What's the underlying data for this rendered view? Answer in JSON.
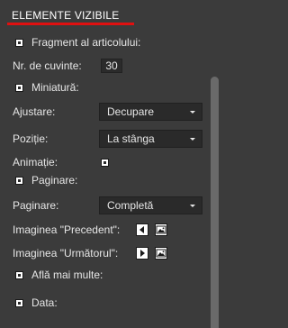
{
  "section": {
    "title": "ELEMENTE VIZIBILE"
  },
  "items": {
    "fragment": {
      "label": "Fragment al articolului:"
    },
    "word_count": {
      "label": "Nr. de cuvinte:",
      "value": "30"
    },
    "thumbnail": {
      "label": "Miniatură:"
    },
    "adjust": {
      "label": "Ajustare:",
      "selected": "Decupare"
    },
    "position": {
      "label": "Poziție:",
      "selected": "La stânga"
    },
    "animation": {
      "label": "Animație:"
    },
    "paging_toggle": {
      "label": "Paginare:"
    },
    "paging": {
      "label": "Paginare:",
      "selected": "Completă"
    },
    "prev_image": {
      "label": "Imaginea \"Precedent\":"
    },
    "next_image": {
      "label": "Imaginea \"Următorul\":"
    },
    "read_more": {
      "label": "Află mai multe:"
    },
    "date": {
      "label": "Data:"
    }
  },
  "icons": {
    "prev_arrow": "arrow-left-icon",
    "next_arrow": "arrow-right-icon",
    "image": "image-icon",
    "caret": "chevron-down-icon"
  },
  "colors": {
    "background": "#3b3b3b",
    "accent_underline": "#e01010",
    "field_background": "#2a2a2a",
    "scroll_thumb": "#6a6a6a"
  }
}
